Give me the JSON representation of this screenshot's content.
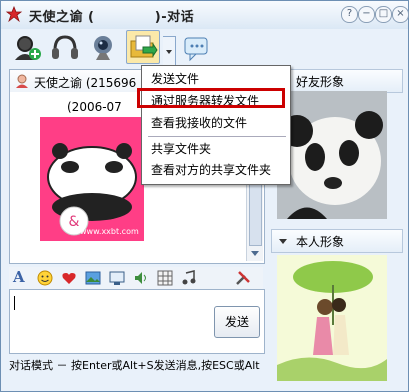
{
  "window": {
    "title": "天使之谕 (            )-对话",
    "controls": [
      "?",
      "−",
      "□",
      "×"
    ]
  },
  "chat": {
    "sender": "天使之谕 (215696",
    "timestamp": "(2006-07",
    "sticker_watermark": "www.xxbt.com"
  },
  "file_menu": {
    "items": [
      "发送文件",
      "通过服务器转发文件",
      "查看我接收的文件",
      "共享文件夹",
      "查看对方的共享文件夹"
    ]
  },
  "input": {
    "send_label": "发送",
    "status_text": "对话模式 － 按Enter或Alt+S发送消息,按ESC或Alt"
  },
  "right_panel": {
    "friend_header": "好友形象",
    "self_header": "本人形象"
  }
}
